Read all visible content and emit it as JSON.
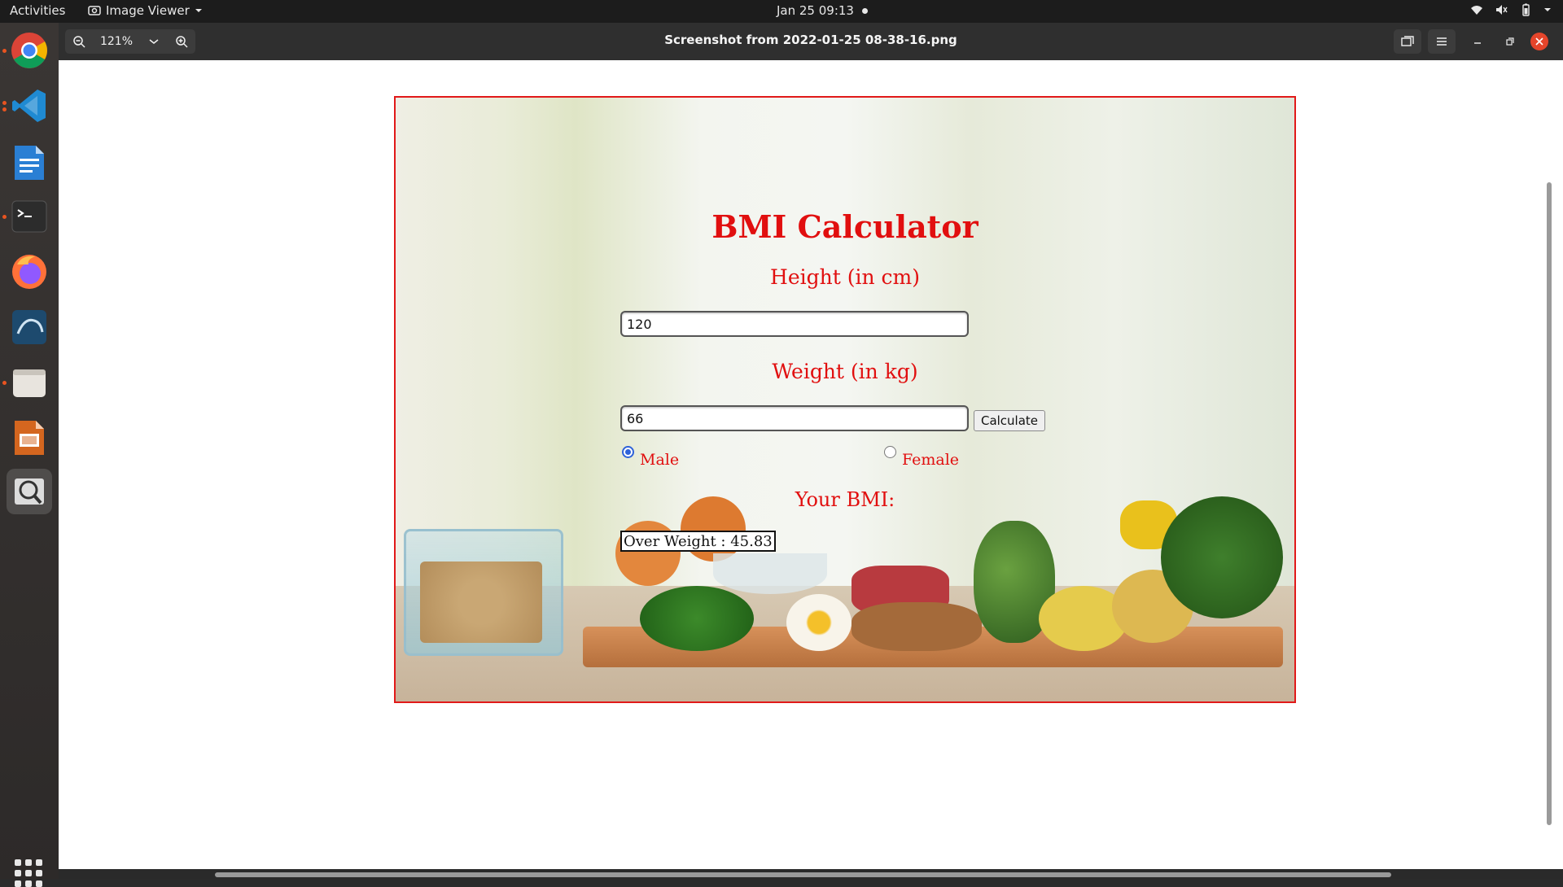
{
  "topbar": {
    "activities": "Activities",
    "app_menu": "Image Viewer",
    "clock": "Jan 25  09:13"
  },
  "dock": {
    "items": [
      "chrome-icon",
      "vscode-icon",
      "writer-icon",
      "terminal-icon",
      "firefox-icon",
      "mysql-workbench-icon",
      "files-icon",
      "impress-icon",
      "image-viewer-icon"
    ]
  },
  "viewer": {
    "zoom": "121%",
    "title": "Screenshot from 2022-01-25 08-38-16.png"
  },
  "bmi": {
    "title": "BMI Calculator",
    "height_label": "Height (in cm)",
    "height_value": "120",
    "weight_label": "Weight (in kg)",
    "weight_value": "66",
    "calculate_label": "Calculate",
    "male_label": "Male",
    "female_label": "Female",
    "selected_gender": "Male",
    "result_label": "Your BMI:",
    "result_value": "Over Weight : 45.83"
  },
  "colors": {
    "accent_red": "#e10f0f",
    "ubuntu_orange": "#e95420",
    "close_button": "#e5452b"
  }
}
